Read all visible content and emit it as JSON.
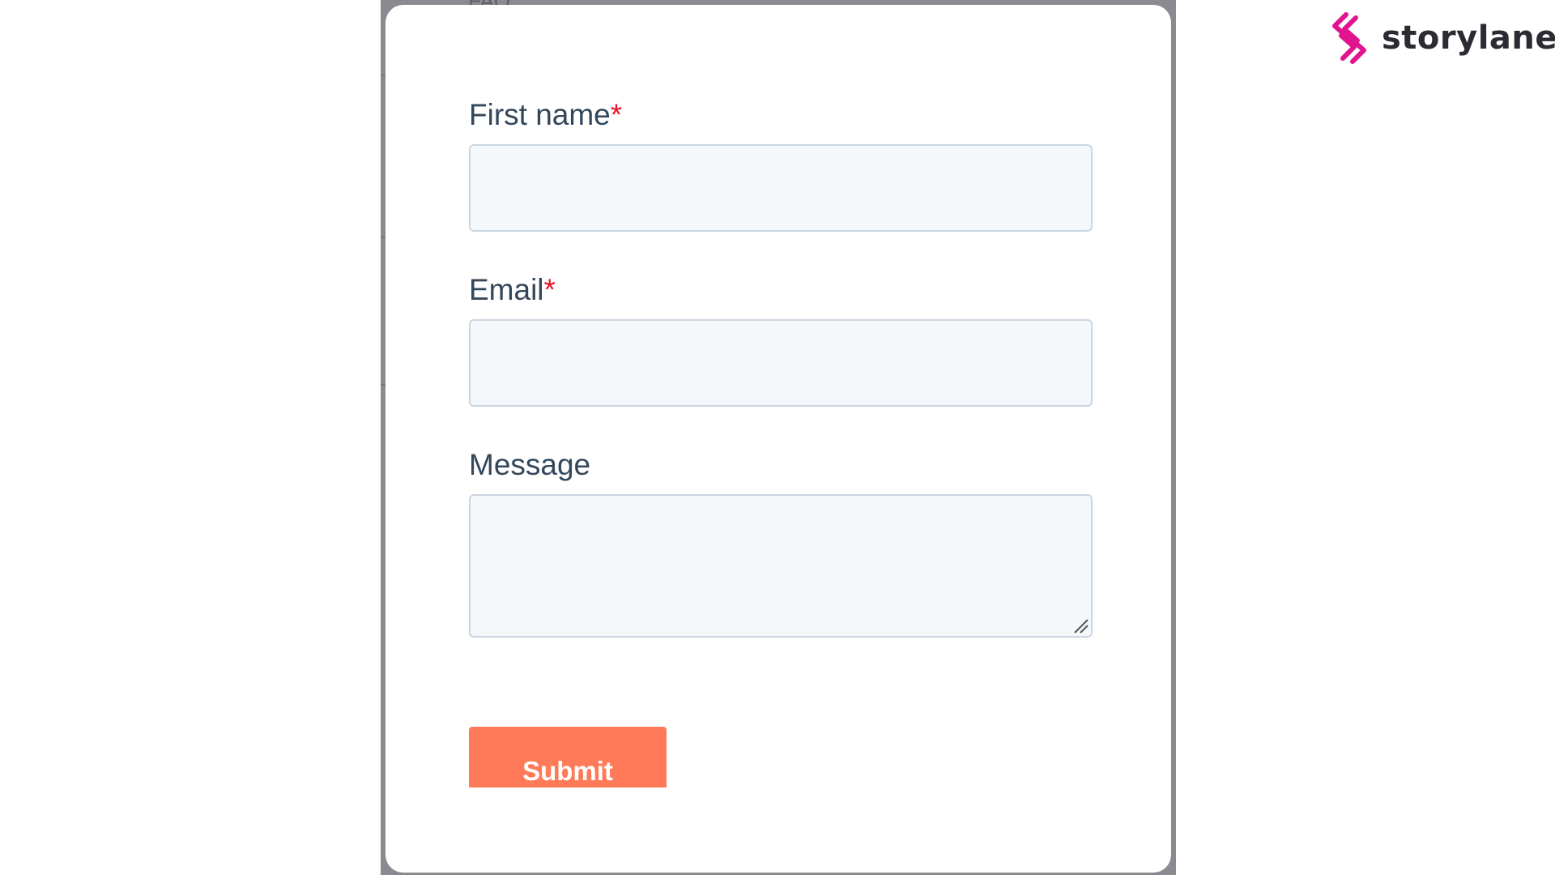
{
  "brand": {
    "name": "storylane",
    "accent_color": "#e0148f",
    "logo_icon": "storylane-logo-icon"
  },
  "form": {
    "fields": [
      {
        "label": "First name",
        "required_marker": "*",
        "value": "",
        "placeholder": ""
      },
      {
        "label": "Email",
        "required_marker": "*",
        "value": "",
        "placeholder": ""
      },
      {
        "label": "Message",
        "required_marker": "",
        "value": "",
        "placeholder": ""
      }
    ],
    "submit_label": "Submit",
    "submit_color": "#ff7a59",
    "required_color": "#e3142a",
    "label_color": "#33475b"
  },
  "backdrop": {
    "fragment_text": "FAQ"
  }
}
